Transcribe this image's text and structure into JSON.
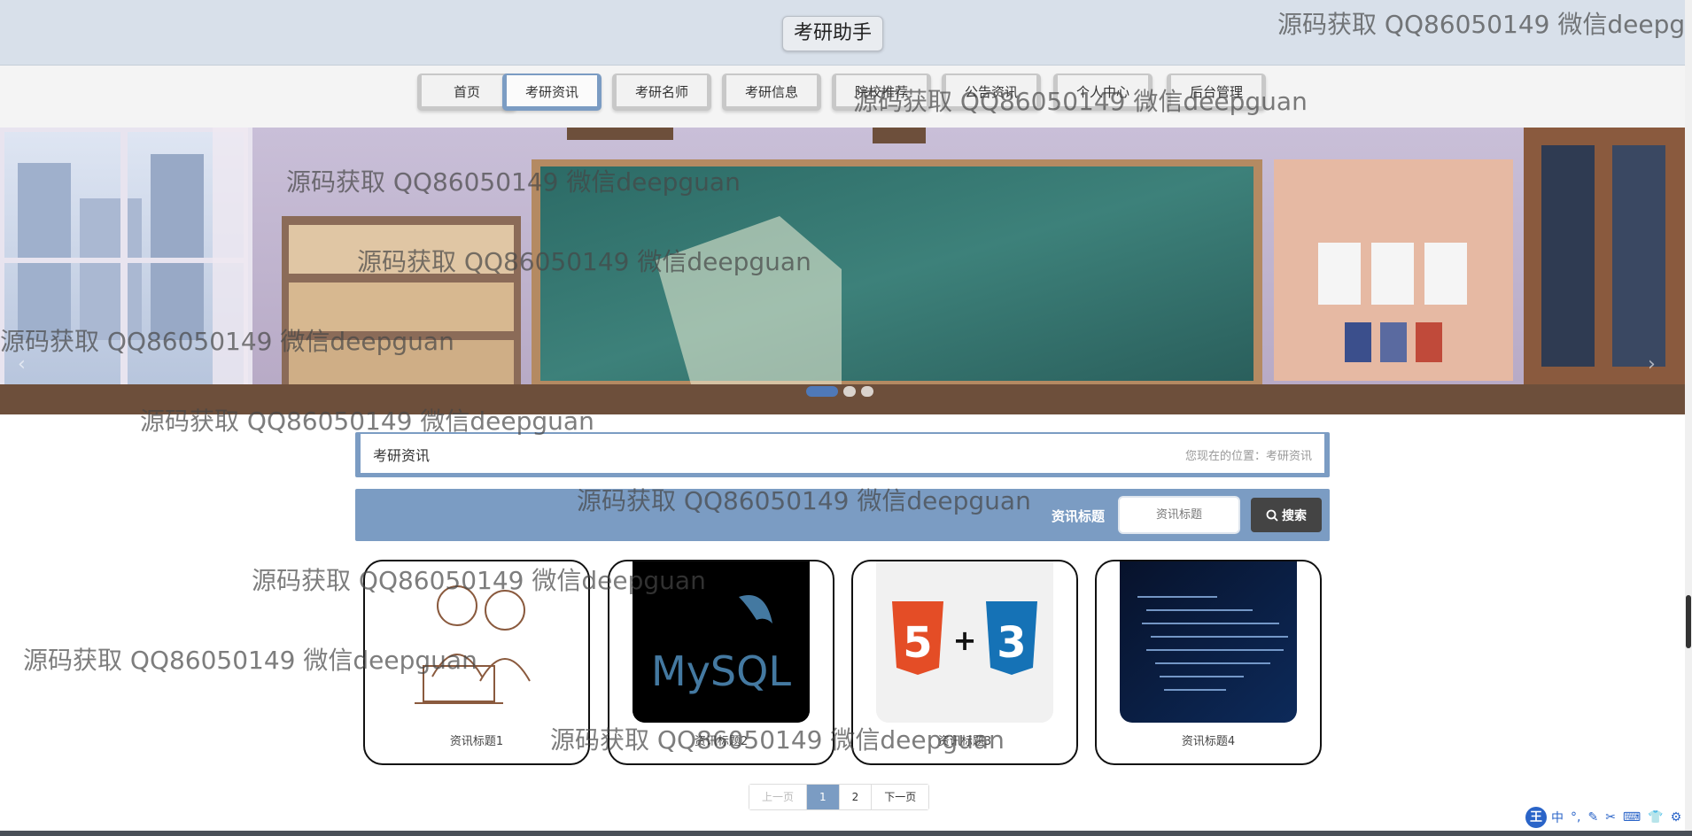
{
  "header": {
    "title": "考研助手"
  },
  "nav": {
    "items": [
      {
        "label": "首页"
      },
      {
        "label": "考研资讯"
      },
      {
        "label": "考研名师"
      },
      {
        "label": "考研信息"
      },
      {
        "label": "院校推荐"
      },
      {
        "label": "公告资讯"
      },
      {
        "label": "个人中心"
      },
      {
        "label": "后台管理"
      }
    ],
    "active": "考研资讯"
  },
  "banner": {
    "slide_count": 3,
    "active_slide": 1,
    "prev_icon": "chevron-left-icon",
    "next_icon": "chevron-right-icon"
  },
  "section": {
    "title": "考研资讯",
    "location": "您现在的位置：考研资讯"
  },
  "search": {
    "label": "资讯标题",
    "placeholder": "资讯标题",
    "button_label": "搜索",
    "button_icon": "search-icon"
  },
  "cards": [
    {
      "title": "资讯标题1"
    },
    {
      "title": "资讯标题2",
      "image_text": "MySQL"
    },
    {
      "title": "资讯标题3"
    },
    {
      "title": "资讯标题4"
    }
  ],
  "pagination": {
    "prev": "上一页",
    "pages": [
      "1",
      "2"
    ],
    "current": "1",
    "next": "下一页"
  },
  "watermark": {
    "text": "源码获取 QQ86050149 微信deepguan"
  },
  "ime": {
    "logo": "王",
    "items": [
      "中",
      "°,",
      "✎",
      "✂",
      "⌨",
      "👕",
      "⚙"
    ]
  },
  "colors": {
    "accent": "#7b9cc3",
    "header_bg": "#d8e0ea",
    "search_button": "#444444"
  }
}
